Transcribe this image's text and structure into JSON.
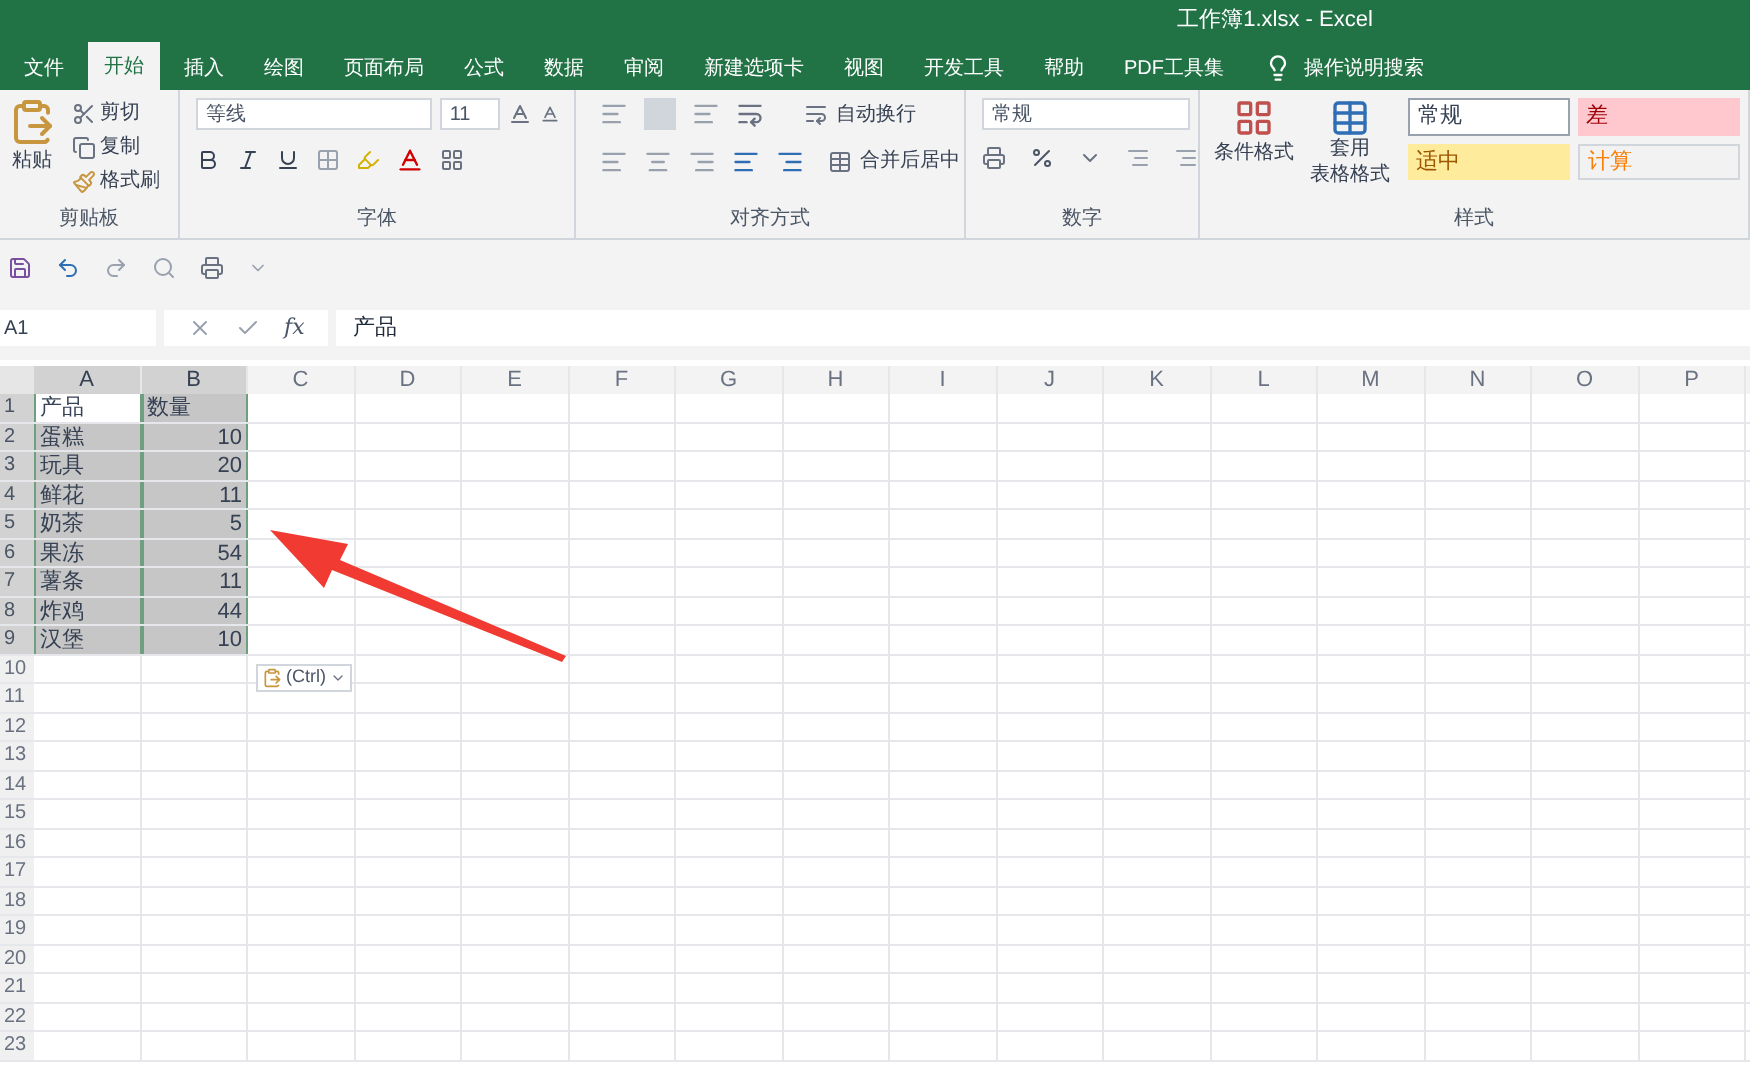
{
  "window": {
    "title": "工作簿1.xlsx  -  Excel"
  },
  "tabs": [
    {
      "label": "文件",
      "selected": false
    },
    {
      "label": "开始",
      "selected": true
    },
    {
      "label": "插入",
      "selected": false
    },
    {
      "label": "绘图",
      "selected": false
    },
    {
      "label": "页面布局",
      "selected": false
    },
    {
      "label": "公式",
      "selected": false
    },
    {
      "label": "数据",
      "selected": false
    },
    {
      "label": "审阅",
      "selected": false
    },
    {
      "label": "新建选项卡",
      "selected": false
    },
    {
      "label": "视图",
      "selected": false
    },
    {
      "label": "开发工具",
      "selected": false
    },
    {
      "label": "帮助",
      "selected": false
    },
    {
      "label": "PDF工具集",
      "selected": false
    }
  ],
  "tell_me": "操作说明搜索",
  "ribbon": {
    "clipboard": {
      "paste": "粘贴",
      "cut": "剪切",
      "copy": "复制",
      "format_painter": "格式刷",
      "label": "剪贴板"
    },
    "font": {
      "font_name": "等线",
      "font_size": "11",
      "label": "字体"
    },
    "alignment": {
      "wrap_text": "自动换行",
      "merge_center": "合并后居中",
      "label": "对齐方式"
    },
    "number": {
      "format": "常规",
      "label": "数字"
    },
    "styles": {
      "conditional": "条件格式",
      "table_format_1": "套用",
      "table_format_2": "表格格式",
      "label": "样式",
      "cells": [
        {
          "label": "常规",
          "kind": "normal"
        },
        {
          "label": "差",
          "kind": "bad"
        },
        {
          "label": "适中",
          "kind": "neutral"
        },
        {
          "label": "计算",
          "kind": "calculation"
        }
      ]
    }
  },
  "formula_bar": {
    "name_box": "A1",
    "fx": "fx",
    "value": "产品"
  },
  "columns": [
    {
      "letter": "A",
      "selected": true
    },
    {
      "letter": "B",
      "selected": true
    },
    {
      "letter": "C",
      "selected": false
    },
    {
      "letter": "D",
      "selected": false
    },
    {
      "letter": "E",
      "selected": false
    },
    {
      "letter": "F",
      "selected": false
    },
    {
      "letter": "G",
      "selected": false
    },
    {
      "letter": "H",
      "selected": false
    },
    {
      "letter": "I",
      "selected": false
    },
    {
      "letter": "J",
      "selected": false
    },
    {
      "letter": "K",
      "selected": false
    },
    {
      "letter": "L",
      "selected": false
    },
    {
      "letter": "M",
      "selected": false
    },
    {
      "letter": "N",
      "selected": false
    },
    {
      "letter": "O",
      "selected": false
    },
    {
      "letter": "P",
      "selected": false
    }
  ],
  "rows": [
    {
      "number": "1",
      "cells": [
        {
          "text": "产品",
          "selected": true,
          "active": true
        },
        {
          "text": "数量",
          "selected": true,
          "active": false
        }
      ]
    },
    {
      "number": "2",
      "cells": [
        {
          "text": "蛋糕",
          "selected": true,
          "active": false
        },
        {
          "text": "10",
          "selected": true,
          "active": false
        }
      ]
    },
    {
      "number": "3",
      "cells": [
        {
          "text": "玩具",
          "selected": true,
          "active": false
        },
        {
          "text": "20",
          "selected": true,
          "active": false
        }
      ]
    },
    {
      "number": "4",
      "cells": [
        {
          "text": "鲜花",
          "selected": true,
          "active": false
        },
        {
          "text": "11",
          "selected": true,
          "active": false
        }
      ]
    },
    {
      "number": "5",
      "cells": [
        {
          "text": "奶茶",
          "selected": true,
          "active": false
        },
        {
          "text": "5",
          "selected": true,
          "active": false
        }
      ]
    },
    {
      "number": "6",
      "cells": [
        {
          "text": "果冻",
          "selected": true,
          "active": false
        },
        {
          "text": "54",
          "selected": true,
          "active": false
        }
      ]
    },
    {
      "number": "7",
      "cells": [
        {
          "text": "薯条",
          "selected": true,
          "active": false
        },
        {
          "text": "11",
          "selected": true,
          "active": false
        }
      ]
    },
    {
      "number": "8",
      "cells": [
        {
          "text": "炸鸡",
          "selected": true,
          "active": false
        },
        {
          "text": "44",
          "selected": true,
          "active": false
        }
      ]
    },
    {
      "number": "9",
      "cells": [
        {
          "text": "汉堡",
          "selected": true,
          "active": false
        },
        {
          "text": "10",
          "selected": true,
          "active": false
        }
      ]
    },
    {
      "number": "10",
      "cells": []
    },
    {
      "number": "11",
      "cells": []
    },
    {
      "number": "12",
      "cells": []
    },
    {
      "number": "13",
      "cells": []
    },
    {
      "number": "14",
      "cells": []
    },
    {
      "number": "15",
      "cells": []
    },
    {
      "number": "16",
      "cells": []
    },
    {
      "number": "17",
      "cells": []
    },
    {
      "number": "18",
      "cells": []
    },
    {
      "number": "19",
      "cells": []
    },
    {
      "number": "20",
      "cells": []
    },
    {
      "number": "21",
      "cells": []
    },
    {
      "number": "22",
      "cells": []
    },
    {
      "number": "23",
      "cells": []
    }
  ],
  "paste_options": "(Ctrl)"
}
